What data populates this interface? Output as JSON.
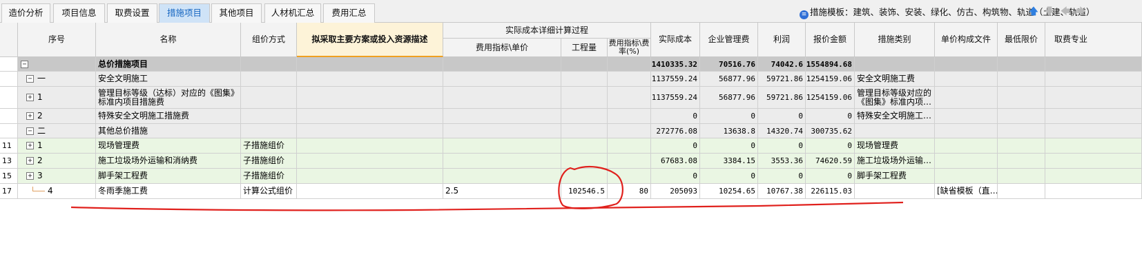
{
  "tabs": [
    {
      "label": "造价分析",
      "active": false
    },
    {
      "label": "项目信息",
      "active": false
    },
    {
      "label": "取费设置",
      "active": false
    },
    {
      "label": "措施项目",
      "active": true
    },
    {
      "label": "其他项目",
      "active": false
    },
    {
      "label": "人材机汇总",
      "active": false
    },
    {
      "label": "费用汇总",
      "active": false
    }
  ],
  "template": {
    "label": "措施模板：建筑、装饰、安装、绿化、仿古、构筑物、轨道（土建、轨道）"
  },
  "nav": {
    "up": "🡅",
    "down": "🡇",
    "left": "🡄",
    "right": "🡆"
  },
  "columns": {
    "seq": "序号",
    "name": "名称",
    "pricing": "组价方式",
    "plan": "拟采取主要方案或投入资源描述",
    "detail_group": "实际成本详细计算过程",
    "index_price": "费用指标\\单价",
    "quantity": "工程量",
    "rate": "费用指标\\费率(%)",
    "actual_cost": "实际成本",
    "mgmt_fee": "企业管理费",
    "profit": "利润",
    "quote": "报价金额",
    "category": "措施类别",
    "unit_file": "单价构成文件",
    "min_price": "最低限价",
    "fee_pro": "取费专业"
  },
  "rows": [
    {
      "line": "",
      "toggle": "−",
      "seq": "",
      "name": "总价措施项目",
      "pricing": "",
      "plan": "",
      "index_price": "",
      "quantity": "",
      "rate": "",
      "actual_cost": "1410335.32",
      "mgmt_fee": "70516.76",
      "profit": "74042.6",
      "quote": "1554894.68",
      "category": "",
      "unit_file": "",
      "min_price": "",
      "fee_pro": "",
      "style": "total"
    },
    {
      "line": "",
      "toggle": "−",
      "seq": "一",
      "name": "安全文明施工",
      "pricing": "",
      "plan": "",
      "index_price": "",
      "quantity": "",
      "rate": "",
      "actual_cost": "1137559.24",
      "mgmt_fee": "56877.96",
      "profit": "59721.86",
      "quote": "1254159.06",
      "category": "安全文明施工费",
      "unit_file": "",
      "min_price": "",
      "fee_pro": "",
      "style": "group"
    },
    {
      "line": "",
      "toggle": "+",
      "seq": "1",
      "name": "管理目标等级（达标）对应的《图集》标准内项目措施费",
      "pricing": "",
      "plan": "",
      "index_price": "",
      "quantity": "",
      "rate": "",
      "actual_cost": "1137559.24",
      "mgmt_fee": "56877.96",
      "profit": "59721.86",
      "quote": "1254159.06",
      "category": "管理目标等级对应的《图集》标准内项…",
      "unit_file": "",
      "min_price": "",
      "fee_pro": "",
      "style": "group"
    },
    {
      "line": "",
      "toggle": "+",
      "seq": "2",
      "name": "特殊安全文明施工措施费",
      "pricing": "",
      "plan": "",
      "index_price": "",
      "quantity": "",
      "rate": "",
      "actual_cost": "0",
      "mgmt_fee": "0",
      "profit": "0",
      "quote": "0",
      "category": "特殊安全文明施工…",
      "unit_file": "",
      "min_price": "",
      "fee_pro": "",
      "style": "group"
    },
    {
      "line": "",
      "toggle": "−",
      "seq": "二",
      "name": "其他总价措施",
      "pricing": "",
      "plan": "",
      "index_price": "",
      "quantity": "",
      "rate": "",
      "actual_cost": "272776.08",
      "mgmt_fee": "13638.8",
      "profit": "14320.74",
      "quote": "300735.62",
      "category": "",
      "unit_file": "",
      "min_price": "",
      "fee_pro": "",
      "style": "group"
    },
    {
      "line": "11",
      "toggle": "+",
      "seq": "1",
      "name": "现场管理费",
      "pricing": "子措施组价",
      "plan": "",
      "index_price": "",
      "quantity": "",
      "rate": "",
      "actual_cost": "0",
      "mgmt_fee": "0",
      "profit": "0",
      "quote": "0",
      "category": "现场管理费",
      "unit_file": "",
      "min_price": "",
      "fee_pro": "",
      "style": "green"
    },
    {
      "line": "13",
      "toggle": "+",
      "seq": "2",
      "name": "施工垃圾场外运输和消纳费",
      "pricing": "子措施组价",
      "plan": "",
      "index_price": "",
      "quantity": "",
      "rate": "",
      "actual_cost": "67683.08",
      "mgmt_fee": "3384.15",
      "profit": "3553.36",
      "quote": "74620.59",
      "category": "施工垃圾场外运输…",
      "unit_file": "",
      "min_price": "",
      "fee_pro": "",
      "style": "green"
    },
    {
      "line": "15",
      "toggle": "+",
      "seq": "3",
      "name": "脚手架工程费",
      "pricing": "子措施组价",
      "plan": "",
      "index_price": "",
      "quantity": "",
      "rate": "",
      "actual_cost": "0",
      "mgmt_fee": "0",
      "profit": "0",
      "quote": "0",
      "category": "脚手架工程费",
      "unit_file": "",
      "min_price": "",
      "fee_pro": "",
      "style": "green"
    },
    {
      "line": "17",
      "toggle": "",
      "seq": "4",
      "name": "冬雨季施工费",
      "pricing": "计算公式组价",
      "plan": "",
      "index_price": "2.5",
      "quantity": "102546.5",
      "rate": "80",
      "actual_cost": "205093",
      "mgmt_fee": "10254.65",
      "profit": "10767.38",
      "quote": "226115.03",
      "category": "",
      "unit_file": "[缺省模板（直…",
      "min_price": "",
      "fee_pro": "",
      "style": "white"
    }
  ],
  "colors": {
    "total_row": "#c8c8c8",
    "group_row": "#ececec",
    "green_row": "#eaf6e3",
    "white_row": "#ffffff",
    "annotation": "#e0201c",
    "active_tab": "#cfe3f7"
  }
}
